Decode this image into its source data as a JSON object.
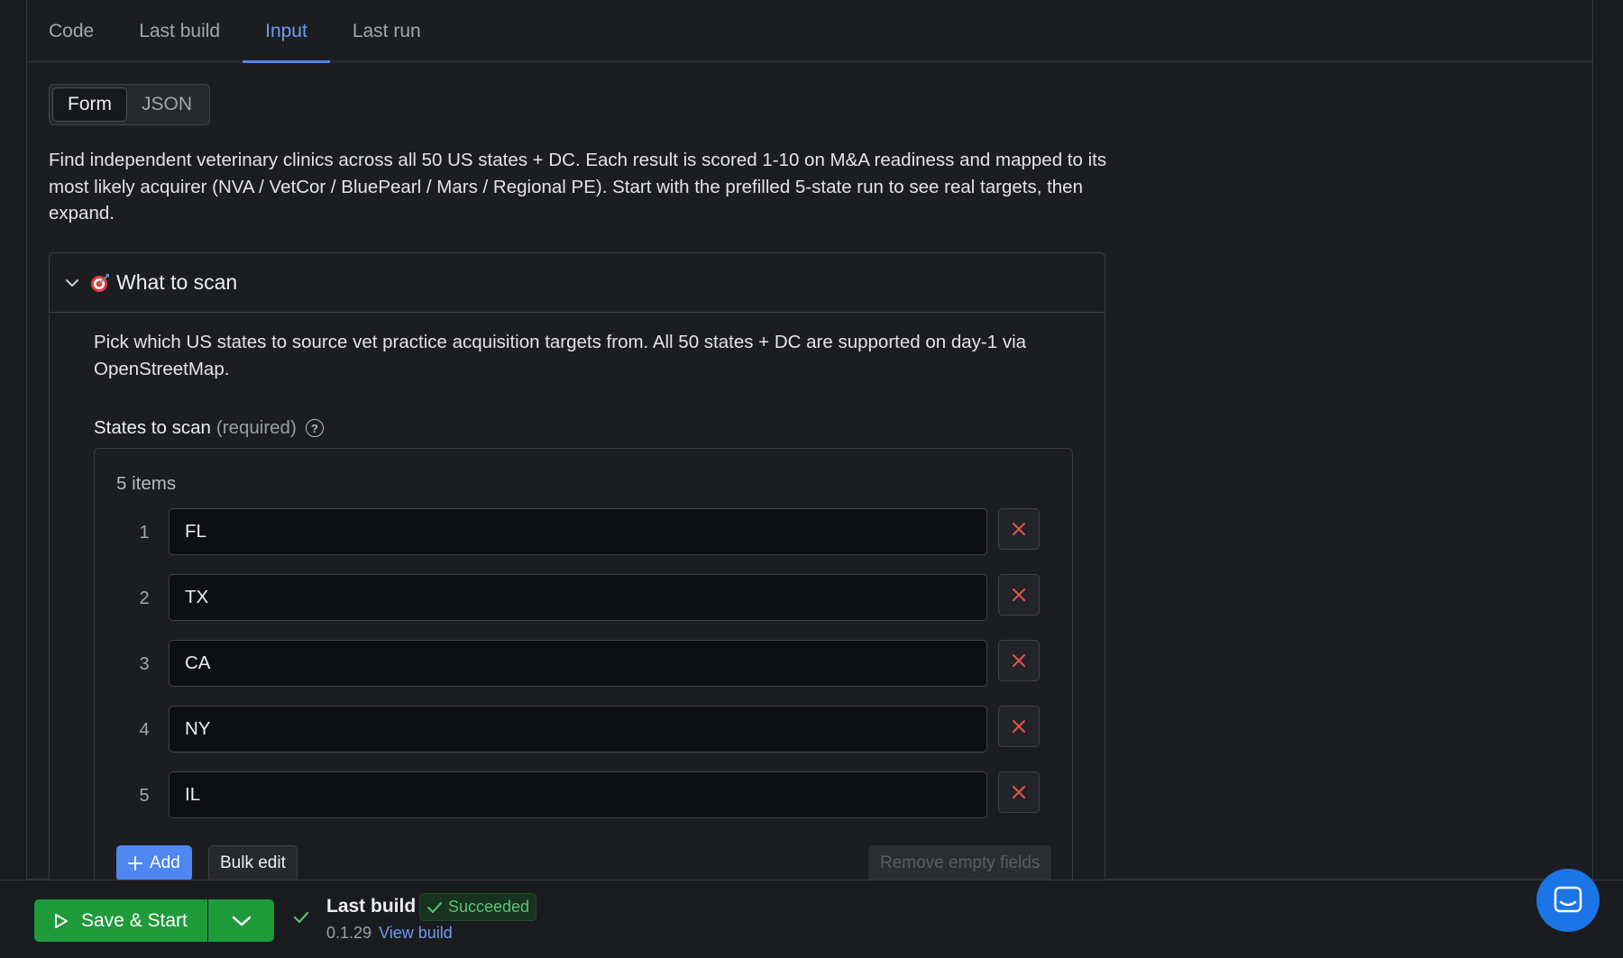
{
  "tabs": [
    {
      "label": "Code"
    },
    {
      "label": "Last build"
    },
    {
      "label": "Input"
    },
    {
      "label": "Last run"
    }
  ],
  "active_tab": "Input",
  "mode_toggle": {
    "form": "Form",
    "json": "JSON"
  },
  "description": "Find independent veterinary clinics across all 50 US states + DC. Each result is scored 1-10 on M&A readiness and mapped to its most likely acquirer (NVA / VetCor / BluePearl / Mars / Regional PE). Start with the prefilled 5-state run to see real targets, then expand.",
  "section": {
    "title": "What to scan",
    "description": "Pick which US states to source vet practice acquisition targets from. All 50 states + DC are supported on day-1 via OpenStreetMap.",
    "field_label": "States to scan",
    "field_required": "(required)",
    "items_count": "5 items",
    "items": [
      {
        "index": "1",
        "value": "FL"
      },
      {
        "index": "2",
        "value": "TX"
      },
      {
        "index": "3",
        "value": "CA"
      },
      {
        "index": "4",
        "value": "NY"
      },
      {
        "index": "5",
        "value": "IL"
      }
    ],
    "add_label": "Add",
    "bulk_edit_label": "Bulk edit",
    "remove_empty_label": "Remove empty fields"
  },
  "footer": {
    "save_label": "Save & Start",
    "last_build_label": "Last build",
    "status": "Succeeded",
    "version": "0.1.29",
    "view_build": "View build"
  },
  "colors": {
    "accent": "#4f86f0",
    "success": "#1f9a3b",
    "danger": "#e5534b",
    "chat": "#1b75e6"
  }
}
